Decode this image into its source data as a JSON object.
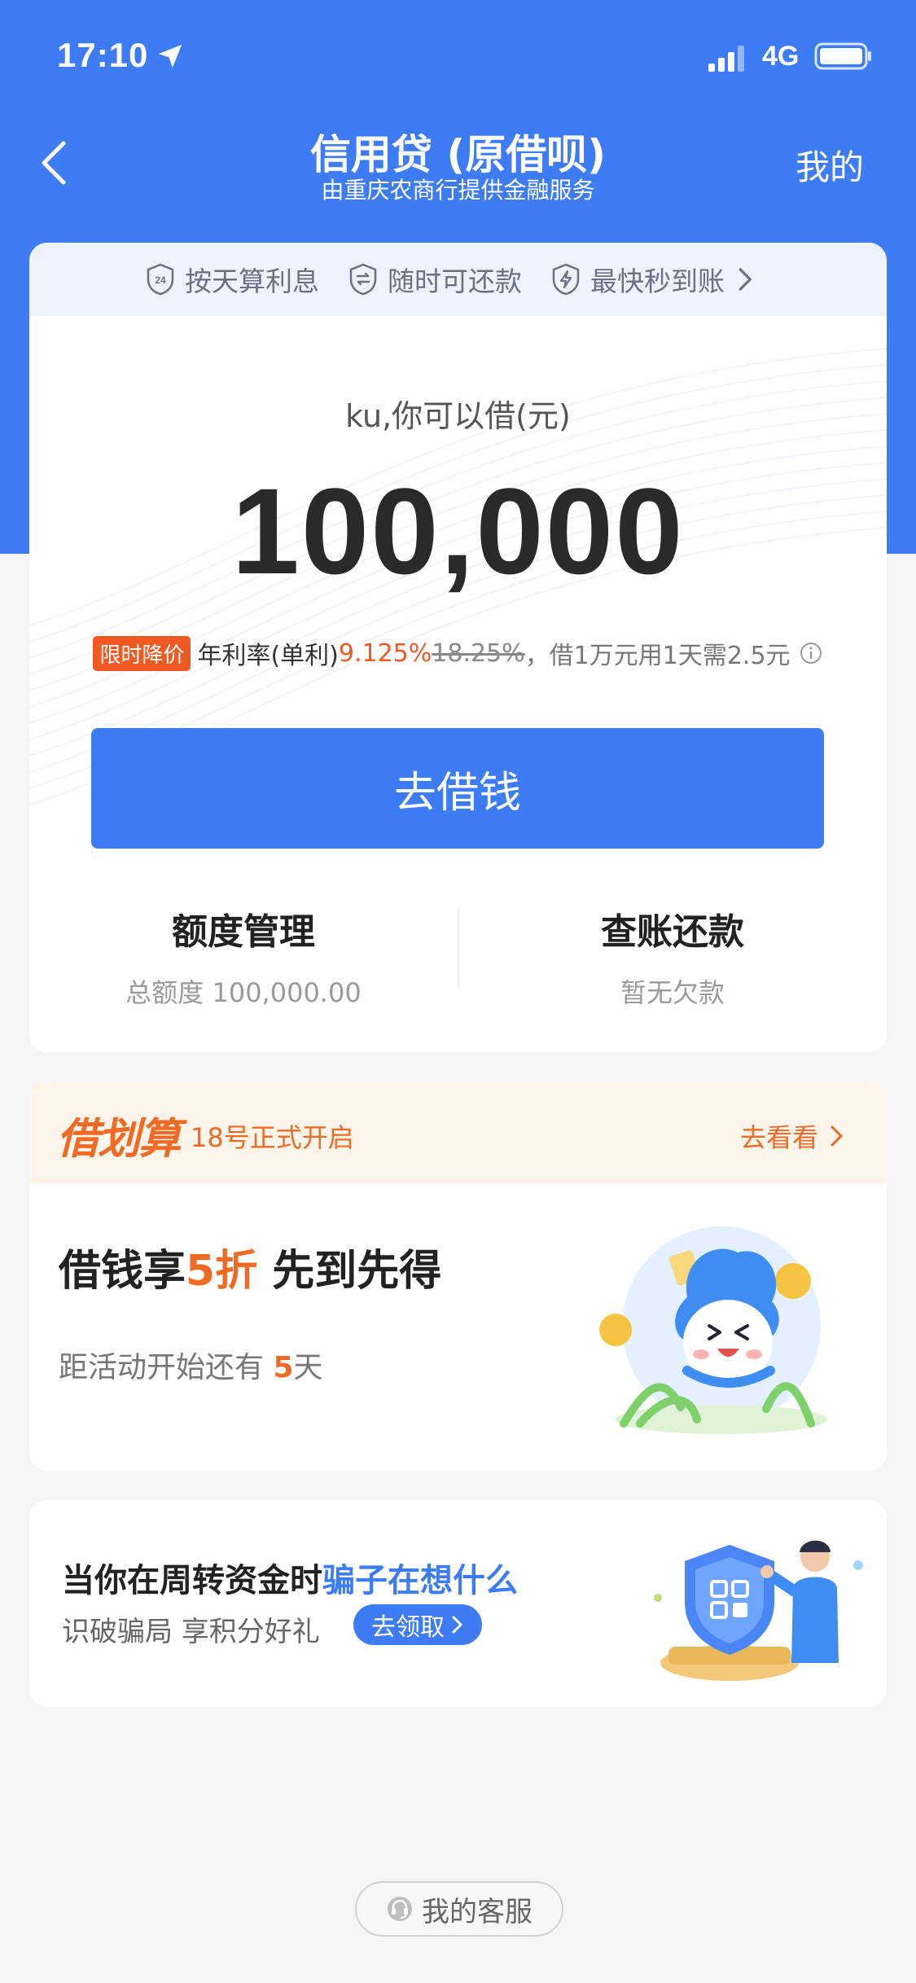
{
  "status_bar": {
    "time": "17:10",
    "network": "4G"
  },
  "nav": {
    "title": "信用贷 (原借呗)",
    "subtitle": "由重庆农商行提供金融服务",
    "right_label": "我的"
  },
  "features": [
    {
      "icon": "24h-shield-icon",
      "label": "按天算利息"
    },
    {
      "icon": "exchange-shield-icon",
      "label": "随时可还款"
    },
    {
      "icon": "lightning-shield-icon",
      "label": "最快秒到账"
    }
  ],
  "loan": {
    "label": "ku,你可以借(元)",
    "amount": "100,000",
    "rate_tag": "限时降价",
    "rate_prefix": "年利率(单利)",
    "rate_current": "9.125%",
    "rate_old": "18.25%",
    "rate_example": "，借1万元用1天需2.5元",
    "borrow_button": "去借钱"
  },
  "quota": {
    "title": "额度管理",
    "sub": "总额度 100,000.00"
  },
  "repay": {
    "title": "查账还款",
    "sub": "暂无欠款"
  },
  "promo": {
    "logo": "借划算",
    "date": "18号正式开启",
    "link": "去看看",
    "title_a": "借钱享",
    "title_hl": "5折",
    "title_b": " 先到先得",
    "countdown_a": "距活动开始还有 ",
    "countdown_hl": "5",
    "countdown_b": "天"
  },
  "fraud": {
    "title_a": "当你在周转资金时",
    "title_hl": "骗子在想什么",
    "sub": "识破骗局 享积分好礼",
    "button": "去领取"
  },
  "service": {
    "label": "我的客服"
  },
  "colors": {
    "primary": "#3d7cf5",
    "accent": "#f06a26",
    "background": "#f5f5f7"
  }
}
